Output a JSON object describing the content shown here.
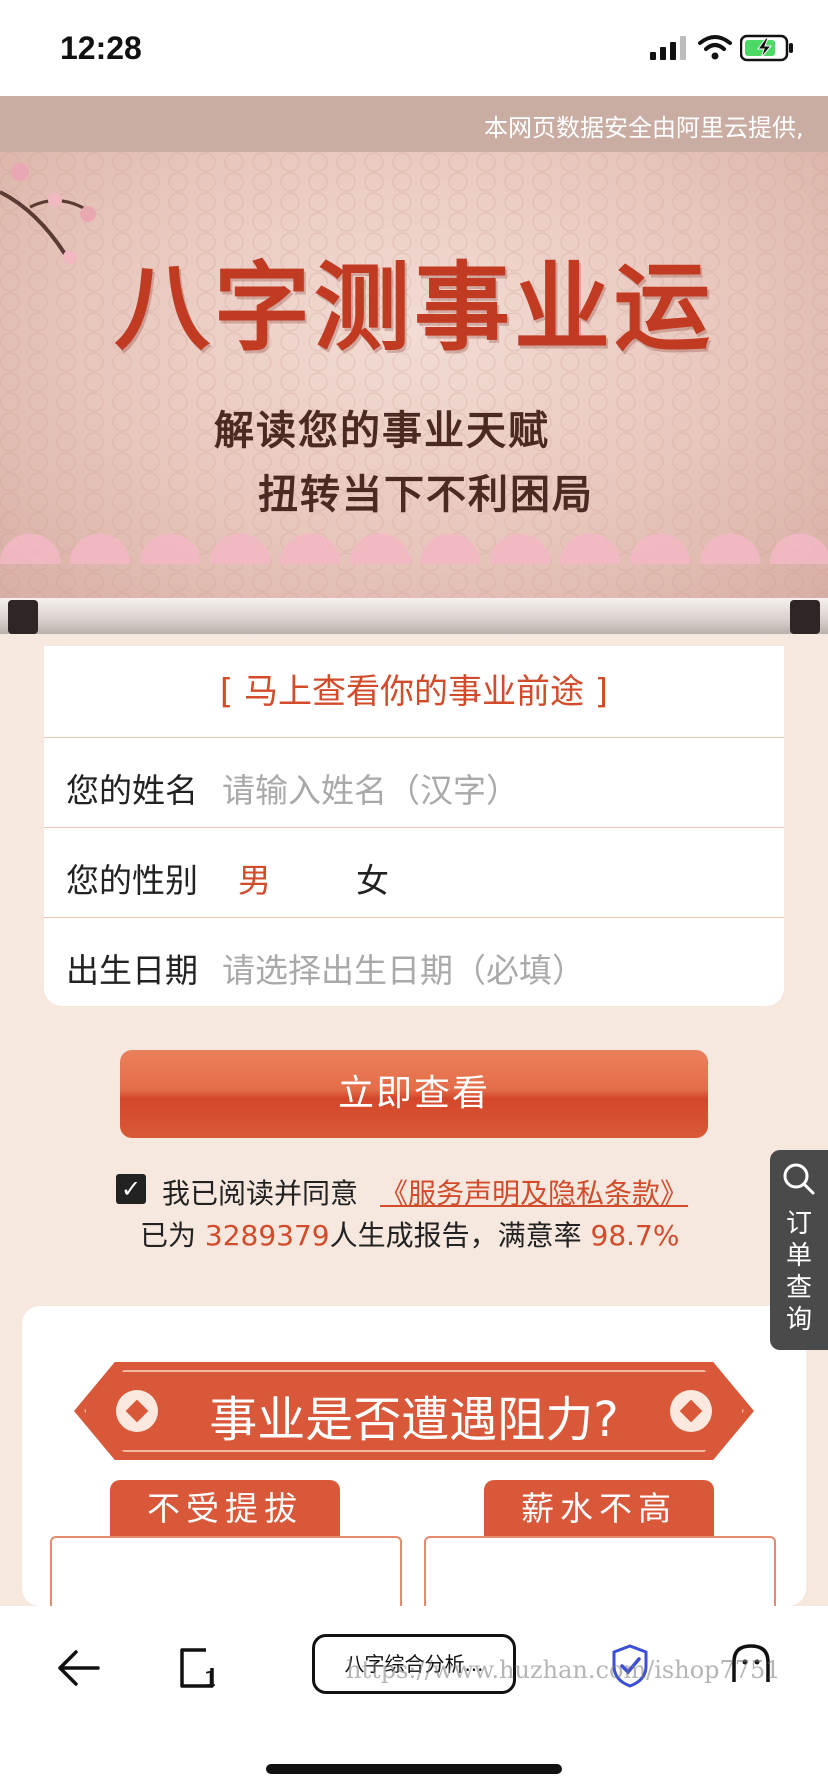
{
  "status_bar": {
    "time": "12:28"
  },
  "notice": {
    "text": "本网页数据安全由阿里云提供,"
  },
  "banner": {
    "title": "八字测事业运",
    "subtitle_line1": "解读您的事业天赋",
    "subtitle_line2": "扭转当下不利困局"
  },
  "form": {
    "headline": "[ 马上查看你的事业前途 ]",
    "name_label": "您的姓名",
    "name_placeholder": "请输入姓名（汉字）",
    "gender_label": "您的性别",
    "gender_options": [
      "男",
      "女"
    ],
    "gender_selected": "男",
    "birth_label": "出生日期",
    "birth_placeholder": "请选择出生日期（必填）"
  },
  "submit_label": "立即查看",
  "agreement": {
    "checked": true,
    "text": "我已阅读并同意",
    "link": "《服务声明及隐私条款》"
  },
  "stats": {
    "prefix": "已为 ",
    "count": "3289379",
    "middle": "人生成报告，满意率 ",
    "rate": "98.7%"
  },
  "side_tab": {
    "label": "订单查询"
  },
  "section": {
    "title": "事业是否遭遇阻力?",
    "tags": [
      "不受提拔",
      "薪水不高"
    ]
  },
  "browser_bar": {
    "page_title": "八字综合分析...",
    "watermark": "https://www.huzhan.com/ishop7751"
  },
  "colors": {
    "accent": "#d24b2a",
    "button": "#d85a36",
    "notice_bg": "#c9ada3",
    "page_bg": "#f7e8df"
  }
}
